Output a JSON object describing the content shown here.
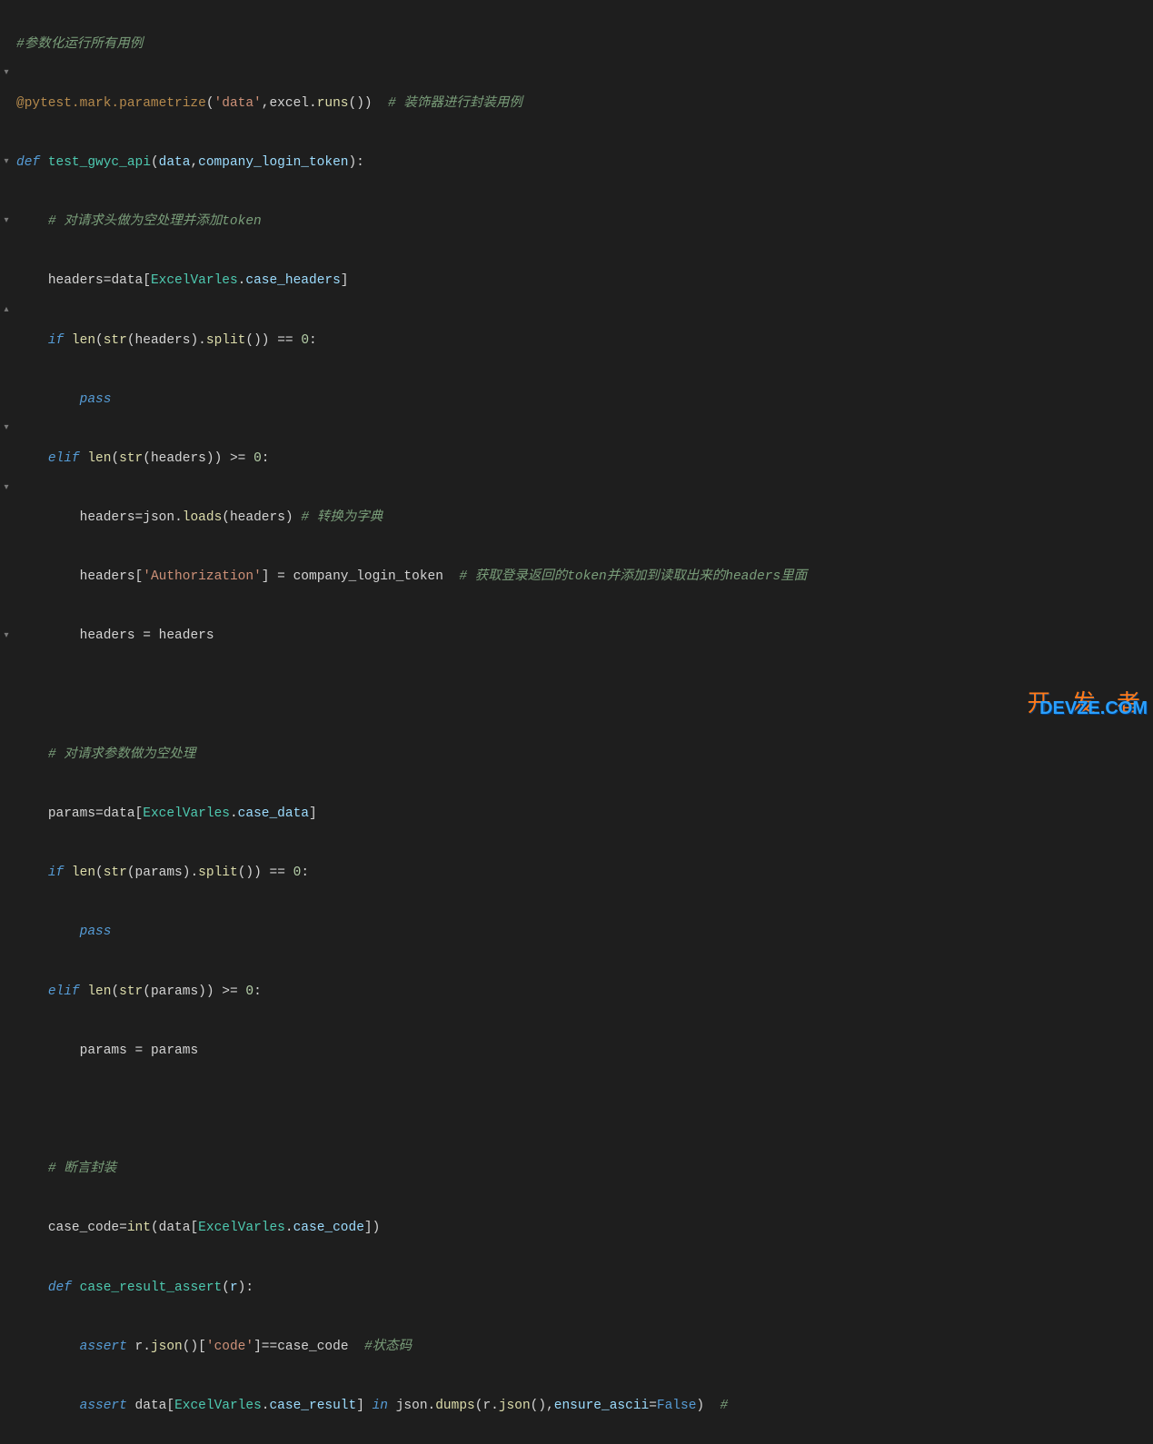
{
  "lines": {
    "l1_comment": "#参数化运行所有用例",
    "l2_decorator": "@pytest.mark.parametrize",
    "l2_args": "('data',excel.runs())",
    "l2_comment": "# 装饰器进行封装用例",
    "l3_def": "def",
    "l3_name": "test_gwyc_api",
    "l3_params": "(data,company_login_token):",
    "l4_comment": "# 对请求头做为空处理并添加token",
    "l5_headers": "headers",
    "l5_data": "data",
    "l5_class": "ExcelVarles",
    "l5_prop": "case_headers",
    "l6_if": "if",
    "l6_len": "len",
    "l6_str": "str",
    "l6_headers": "headers",
    "l6_split": "split",
    "l6_eq": " == ",
    "l6_zero": "0",
    "l7_pass": "pass",
    "l8_elif": "elif",
    "l8_len": "len",
    "l8_str": "str",
    "l8_headers": "headers",
    "l8_ge": " >= ",
    "l8_zero": "0",
    "l9_headers": "headers",
    "l9_json": "json",
    "l9_loads": "loads",
    "l9_arg": "headers",
    "l9_comment": "# 转换为字典",
    "l10_key": "'Authorization'",
    "l10_val": "company_login_token",
    "l10_comment": "# 获取登录返回的token并添加到读取出来的headers里面",
    "l11_a": "headers",
    "l11_b": "headers",
    "l13_comment": "# 对请求参数做为空处理",
    "l14_params": "params",
    "l14_data": "data",
    "l14_class": "ExcelVarles",
    "l14_prop": "case_data",
    "l15_if": "if",
    "l15_params": "params",
    "l15_zero": "0",
    "l16_pass": "pass",
    "l17_elif": "elif",
    "l17_params": "params",
    "l17_zero": "0",
    "l18_a": "params",
    "l18_b": "params",
    "l20_comment": "# 断言封装",
    "l21_var": "case_code",
    "l21_int": "int",
    "l21_data": "data",
    "l21_class": "ExcelVarles",
    "l21_prop": "case_code",
    "l22_def": "def",
    "l22_name": "case_result_assert",
    "l22_param": "r",
    "l23_assert": "assert",
    "l23_r": "r",
    "l23_json": "json",
    "l23_key": "'code'",
    "l23_cc": "case_code",
    "l23_comment": "#状态码",
    "l24_assert": "assert",
    "l24_data": "data",
    "l24_class": "ExcelVarles",
    "l24_prop": "case_result",
    "l24_in": "in",
    "l24_json": "json",
    "l24_dumps": "dumps",
    "l24_r": "r",
    "l24_rjson": "json",
    "l24_kw": "ensure_ascii",
    "l24_false": "False",
    "l24_comment": "# "
  },
  "watermark": {
    "top": "开 发 者",
    "bottom": "DEVZE.COM"
  }
}
